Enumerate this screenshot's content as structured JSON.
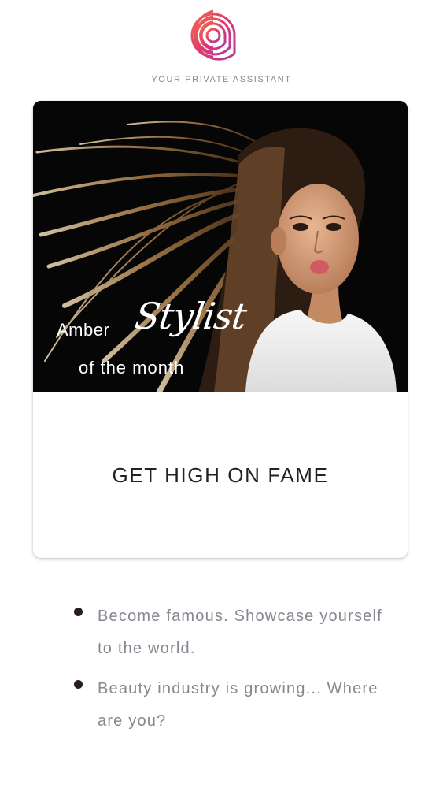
{
  "header": {
    "logo_icon": "assistant-a-logo-icon",
    "tagline": "YOUR PRIVATE ASSISTANT"
  },
  "card": {
    "image": "woman-with-windswept-hair",
    "overlay": {
      "name": "Amber",
      "script_word": "Stylist",
      "subtitle": "of the month"
    },
    "title": "GET HIGH ON FAME"
  },
  "bullets": [
    {
      "text": "Become famous. Showcase yourself to the world."
    },
    {
      "text": "Beauty industry is growing... Where are you?"
    }
  ],
  "colors": {
    "logo_gradient_start": "#f05a5a",
    "logo_gradient_end": "#c2399a",
    "bullet_dot": "#2a1c24",
    "muted_text": "#8a8590"
  }
}
